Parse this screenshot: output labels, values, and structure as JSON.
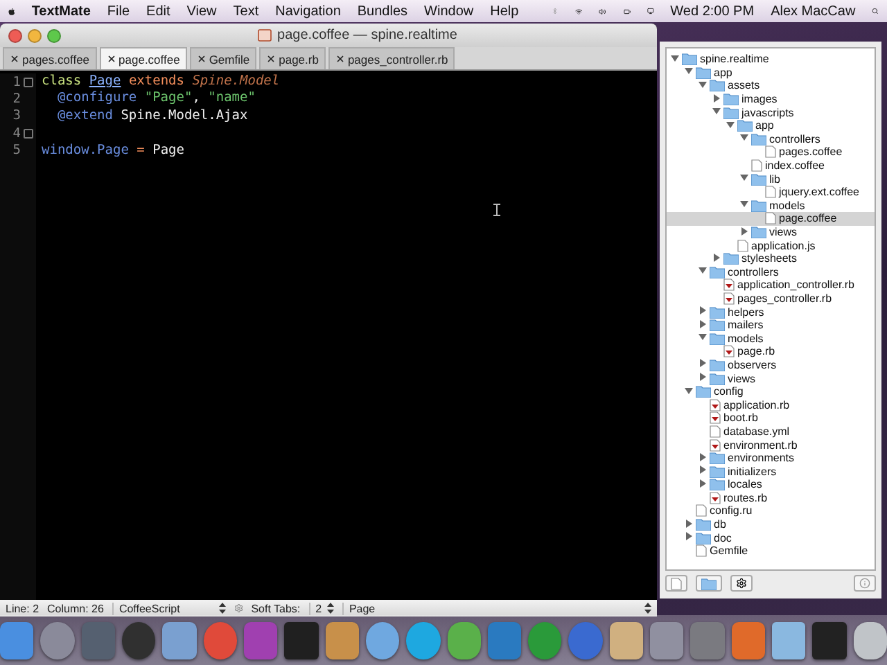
{
  "menu_bar": {
    "app_name": "TextMate",
    "menus": [
      "File",
      "Edit",
      "View",
      "Text",
      "Navigation",
      "Bundles",
      "Window",
      "Help"
    ],
    "clock": "Wed 2:00 PM",
    "user": "Alex MacCaw"
  },
  "window": {
    "title": "page.coffee — spine.realtime"
  },
  "tabs": [
    {
      "label": "pages.coffee",
      "selected": false
    },
    {
      "label": "page.coffee",
      "selected": true
    },
    {
      "label": "Gemfile",
      "selected": false
    },
    {
      "label": "page.rb",
      "selected": false
    },
    {
      "label": "pages_controller.rb",
      "selected": false
    }
  ],
  "code_lines": [
    {
      "number": "1",
      "fold": true,
      "tokens": [
        {
          "text": "class ",
          "kind": "keyword"
        },
        {
          "text": "Page",
          "kind": "class"
        },
        {
          "text": " extends ",
          "kind": "storage"
        },
        {
          "text": "Spine.Model",
          "kind": "inherited"
        }
      ]
    },
    {
      "number": "2",
      "fold": false,
      "tokens": [
        {
          "text": "  @configure ",
          "kind": "variable"
        },
        {
          "text": "\"Page\"",
          "kind": "string"
        },
        {
          "text": ", ",
          "kind": "plain"
        },
        {
          "text": "\"name\"",
          "kind": "string"
        }
      ]
    },
    {
      "number": "3",
      "fold": false,
      "tokens": [
        {
          "text": "  @extend",
          "kind": "variable"
        },
        {
          "text": " Spine.Model.Ajax",
          "kind": "plain"
        }
      ]
    },
    {
      "number": "4",
      "fold": true
    },
    {
      "number": "5",
      "fold": false,
      "tokens": [
        {
          "text": "window.Page",
          "kind": "variable"
        },
        {
          "text": " = ",
          "kind": "operator"
        },
        {
          "text": "Page",
          "kind": "plain"
        }
      ]
    }
  ],
  "status_bar": {
    "line": "Line: 2",
    "column": "Column: 26",
    "language": "CoffeeScript",
    "soft_tabs_label": "Soft Tabs:",
    "soft_tabs_value": "2",
    "symbol": "Page"
  },
  "project_tree": [
    {
      "name": "spine.realtime",
      "kind": "folder",
      "expanded": true,
      "selected": false,
      "children": [
        {
          "name": "app",
          "kind": "folder",
          "expanded": true,
          "selected": false,
          "children": [
            {
              "name": "assets",
              "kind": "folder",
              "expanded": true,
              "selected": false,
              "children": [
                {
                  "name": "images",
                  "kind": "folder",
                  "expanded": false,
                  "selected": false
                },
                {
                  "name": "javascripts",
                  "kind": "folder",
                  "expanded": true,
                  "selected": false,
                  "children": [
                    {
                      "name": "app",
                      "kind": "folder",
                      "expanded": true,
                      "selected": false,
                      "children": [
                        {
                          "name": "controllers",
                          "kind": "folder",
                          "expanded": true,
                          "selected": false,
                          "children": [
                            {
                              "name": "pages.coffee",
                              "kind": "doc",
                              "selected": false
                            }
                          ]
                        },
                        {
                          "name": "index.coffee",
                          "kind": "doc",
                          "selected": false
                        },
                        {
                          "name": "lib",
                          "kind": "folder",
                          "expanded": true,
                          "selected": false,
                          "children": [
                            {
                              "name": "jquery.ext.coffee",
                              "kind": "doc",
                              "selected": false
                            }
                          ]
                        },
                        {
                          "name": "models",
                          "kind": "folder",
                          "expanded": true,
                          "selected": false,
                          "children": [
                            {
                              "name": "page.coffee",
                              "kind": "doc",
                              "selected": true
                            }
                          ]
                        },
                        {
                          "name": "views",
                          "kind": "folder",
                          "expanded": false,
                          "selected": false
                        }
                      ]
                    },
                    {
                      "name": "application.js",
                      "kind": "doc",
                      "selected": false
                    }
                  ]
                },
                {
                  "name": "stylesheets",
                  "kind": "folder",
                  "expanded": false,
                  "selected": false
                }
              ]
            },
            {
              "name": "controllers",
              "kind": "folder",
              "expanded": true,
              "selected": false,
              "children": [
                {
                  "name": "application_controller.rb",
                  "kind": "ruby",
                  "selected": false
                },
                {
                  "name": "pages_controller.rb",
                  "kind": "ruby",
                  "selected": false
                }
              ]
            },
            {
              "name": "helpers",
              "kind": "folder",
              "expanded": false,
              "selected": false
            },
            {
              "name": "mailers",
              "kind": "folder",
              "expanded": false,
              "selected": false
            },
            {
              "name": "models",
              "kind": "folder",
              "expanded": true,
              "selected": false,
              "children": [
                {
                  "name": "page.rb",
                  "kind": "ruby",
                  "selected": false
                }
              ]
            },
            {
              "name": "observers",
              "kind": "folder",
              "expanded": false,
              "selected": false
            },
            {
              "name": "views",
              "kind": "folder",
              "expanded": false,
              "selected": false
            }
          ]
        },
        {
          "name": "config",
          "kind": "folder",
          "expanded": true,
          "selected": false,
          "children": [
            {
              "name": "application.rb",
              "kind": "ruby",
              "selected": false
            },
            {
              "name": "boot.rb",
              "kind": "ruby",
              "selected": false
            },
            {
              "name": "database.yml",
              "kind": "doc",
              "selected": false
            },
            {
              "name": "environment.rb",
              "kind": "ruby",
              "selected": false
            },
            {
              "name": "environments",
              "kind": "folder",
              "expanded": false,
              "selected": false
            },
            {
              "name": "initializers",
              "kind": "folder",
              "expanded": false,
              "selected": false
            },
            {
              "name": "locales",
              "kind": "folder",
              "expanded": false,
              "selected": false
            },
            {
              "name": "routes.rb",
              "kind": "ruby",
              "selected": false
            }
          ]
        },
        {
          "name": "config.ru",
          "kind": "doc",
          "selected": false
        },
        {
          "name": "db",
          "kind": "folder",
          "expanded": false,
          "selected": false
        },
        {
          "name": "doc",
          "kind": "folder",
          "expanded": false,
          "selected": false
        },
        {
          "name": "Gemfile",
          "kind": "doc",
          "selected": false
        }
      ]
    }
  ]
}
